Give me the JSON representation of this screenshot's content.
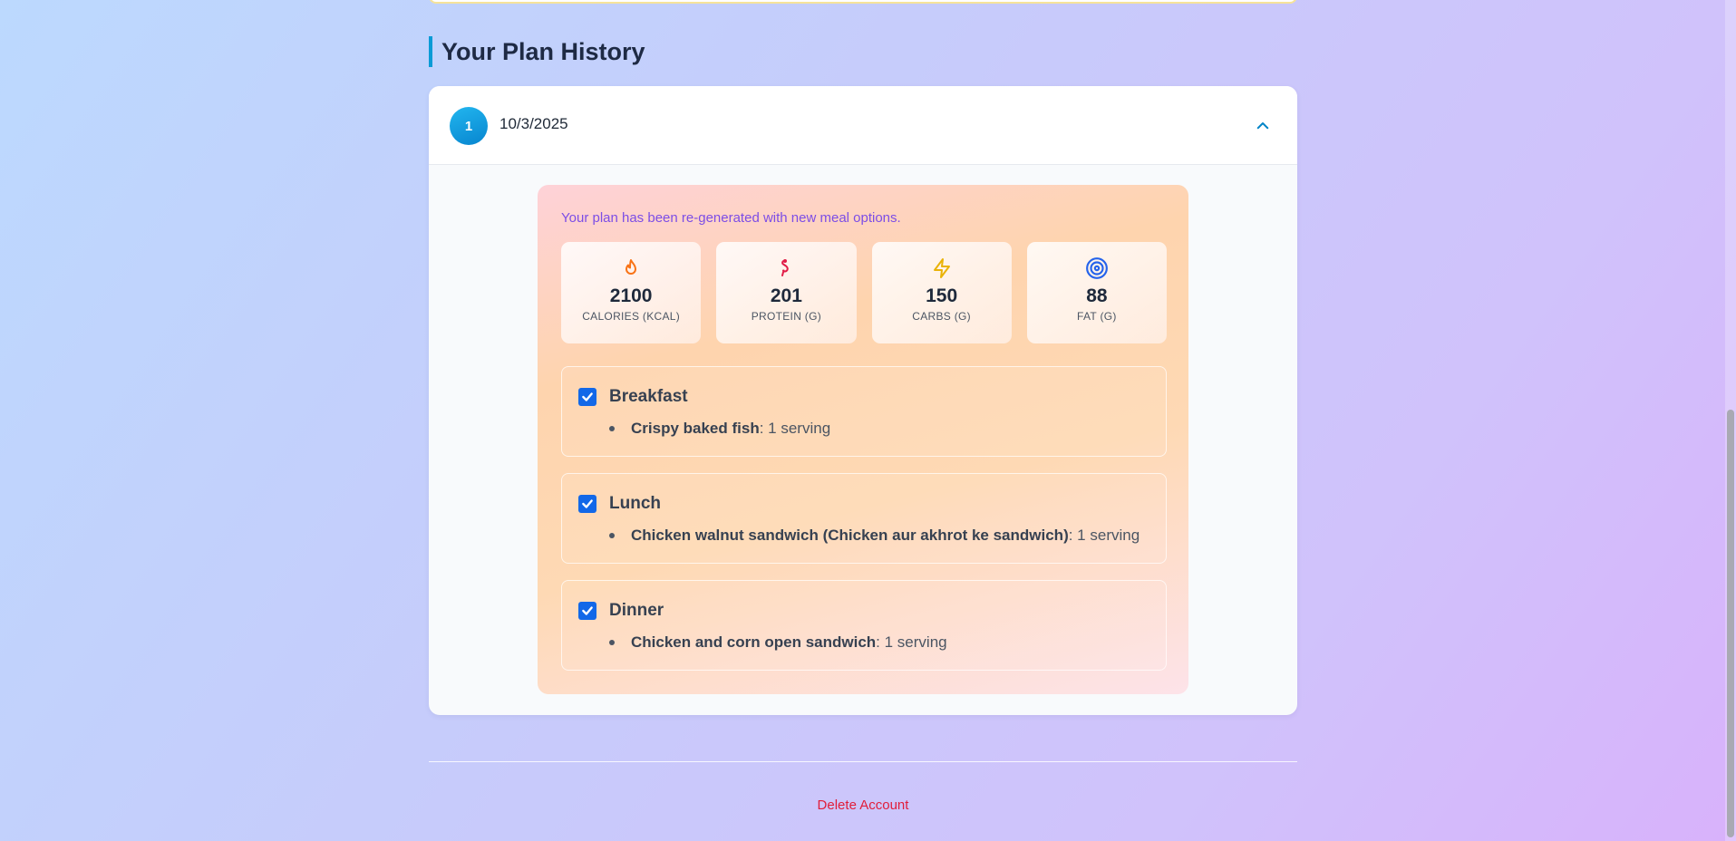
{
  "history": {
    "title": "Your Plan History",
    "entry": {
      "index": "1",
      "date": "10/3/2025",
      "message": "Your plan has been re-generated with new meal options.",
      "stats": [
        {
          "icon": "flame-icon",
          "value": "2100",
          "label": "CALORIES (KCAL)",
          "color": "#f97316"
        },
        {
          "icon": "protein-icon",
          "value": "201",
          "label": "PROTEIN (G)",
          "color": "#e11d48"
        },
        {
          "icon": "lightning-icon",
          "value": "150",
          "label": "CARBS (G)",
          "color": "#eab308"
        },
        {
          "icon": "target-icon",
          "value": "88",
          "label": "FAT (G)",
          "color": "#2563eb"
        }
      ],
      "meals": [
        {
          "title": "Breakfast",
          "checked": true,
          "item": {
            "name": "Crispy baked fish",
            "qty": ": 1 serving"
          }
        },
        {
          "title": "Lunch",
          "checked": true,
          "item": {
            "name": "Chicken walnut sandwich (Chicken aur akhrot ke sandwich)",
            "qty": ": 1 serving"
          }
        },
        {
          "title": "Dinner",
          "checked": true,
          "item": {
            "name": "Chicken and corn open sandwich",
            "qty": ": 1 serving"
          }
        }
      ]
    }
  },
  "footer": {
    "delete_label": "Delete Account"
  }
}
